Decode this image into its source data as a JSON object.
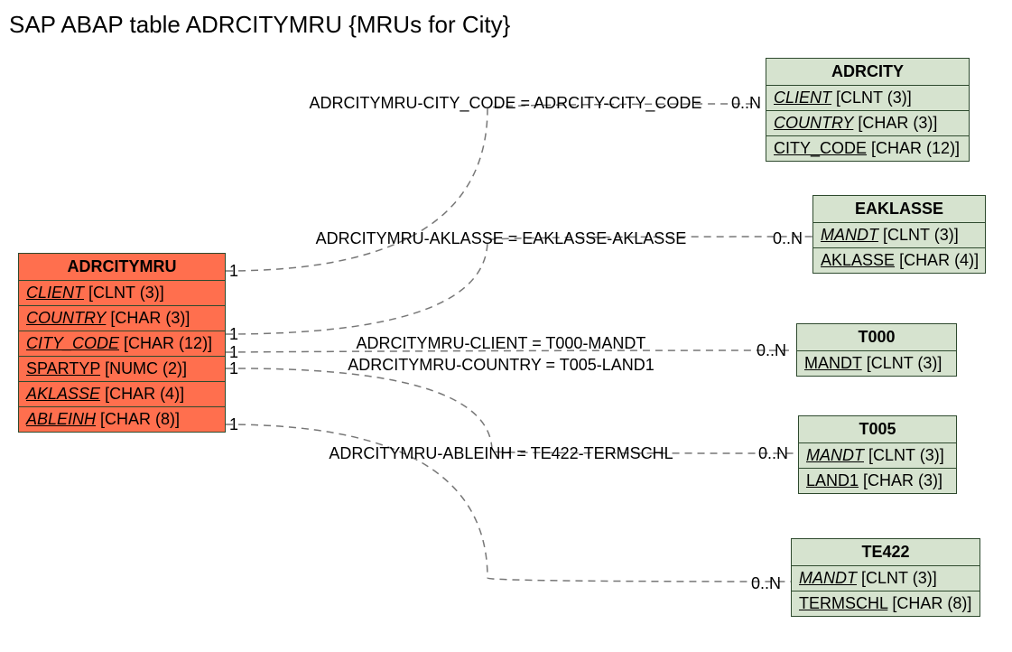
{
  "title": "SAP ABAP table ADRCITYMRU {MRUs for City}",
  "colors": {
    "green": "#d6e3cf",
    "orange": "#ff6f4e",
    "border": "#2e4a2e"
  },
  "mainEntity": {
    "name": "ADRCITYMRU",
    "fields": [
      {
        "name": "CLIENT",
        "type": "[CLNT (3)]",
        "fk": true
      },
      {
        "name": "COUNTRY",
        "type": "[CHAR (3)]",
        "fk": true
      },
      {
        "name": "CITY_CODE",
        "type": "[CHAR (12)]",
        "fk": true
      },
      {
        "name": "SPARTYP",
        "type": "[NUMC (2)]",
        "key": true
      },
      {
        "name": "AKLASSE",
        "type": "[CHAR (4)]",
        "fk": true
      },
      {
        "name": "ABLEINH",
        "type": "[CHAR (8)]",
        "fk": true
      }
    ]
  },
  "relEntities": [
    {
      "name": "ADRCITY",
      "fields": [
        {
          "name": "CLIENT",
          "type": "[CLNT (3)]",
          "fk": true
        },
        {
          "name": "COUNTRY",
          "type": "[CHAR (3)]",
          "fk": true
        },
        {
          "name": "CITY_CODE",
          "type": "[CHAR (12)]",
          "key": true
        }
      ]
    },
    {
      "name": "EAKLASSE",
      "fields": [
        {
          "name": "MANDT",
          "type": "[CLNT (3)]",
          "fk": true
        },
        {
          "name": "AKLASSE",
          "type": "[CHAR (4)]",
          "key": true
        }
      ]
    },
    {
      "name": "T000",
      "fields": [
        {
          "name": "MANDT",
          "type": "[CLNT (3)]",
          "key": true
        }
      ]
    },
    {
      "name": "T005",
      "fields": [
        {
          "name": "MANDT",
          "type": "[CLNT (3)]",
          "fk": true
        },
        {
          "name": "LAND1",
          "type": "[CHAR (3)]",
          "key": true
        }
      ]
    },
    {
      "name": "TE422",
      "fields": [
        {
          "name": "MANDT",
          "type": "[CLNT (3)]",
          "fk": true
        },
        {
          "name": "TERMSCHL",
          "type": "[CHAR (8)]",
          "key": true
        }
      ]
    }
  ],
  "relations": [
    {
      "label": "ADRCITYMRU-CITY_CODE = ADRCITY-CITY_CODE",
      "left": "1",
      "right": "0..N"
    },
    {
      "label": "ADRCITYMRU-AKLASSE = EAKLASSE-AKLASSE",
      "left": "1",
      "right": "0..N"
    },
    {
      "label": "ADRCITYMRU-CLIENT = T000-MANDT",
      "left": "1",
      "right": "0..N"
    },
    {
      "label": "ADRCITYMRU-COUNTRY = T005-LAND1",
      "left": "1",
      "right": ""
    },
    {
      "label": "ADRCITYMRU-ABLEINH = TE422-TERMSCHL",
      "left": "1",
      "right": "0..N"
    }
  ],
  "extraCards": {
    "oneAfterCountry": "1"
  }
}
